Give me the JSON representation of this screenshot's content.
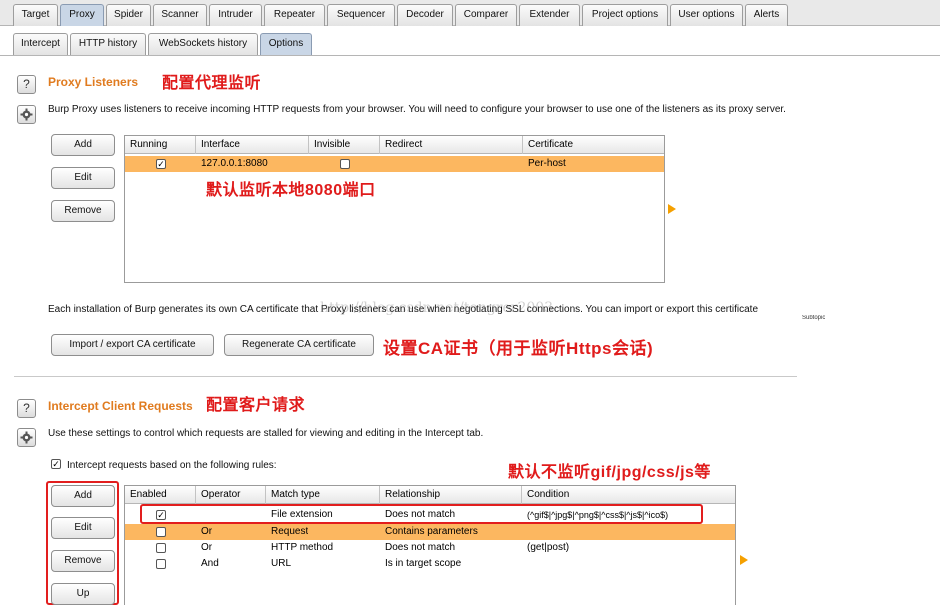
{
  "main_tabs": [
    "Target",
    "Proxy",
    "Spider",
    "Scanner",
    "Intruder",
    "Repeater",
    "Sequencer",
    "Decoder",
    "Comparer",
    "Extender",
    "Project options",
    "User options",
    "Alerts"
  ],
  "sub_tabs": [
    "Intercept",
    "HTTP history",
    "WebSockets history",
    "Options"
  ],
  "proxy_listeners": {
    "help_glyph": "?",
    "title": "Proxy Listeners",
    "annotation": "配置代理监听",
    "description": "Burp Proxy uses listeners to receive incoming HTTP requests from your browser. You will need to configure your browser to use one of the listeners as its proxy server.",
    "buttons": [
      "Add",
      "Edit",
      "Remove"
    ],
    "columns": [
      "Running",
      "Interface",
      "Invisible",
      "Redirect",
      "Certificate"
    ],
    "rows": [
      {
        "running": "✓",
        "interface": "127.0.0.1:8080",
        "invisible": "",
        "redirect": "",
        "certificate": "Per-host"
      }
    ],
    "row_annotation": "默认监听本地8080端口",
    "ca_text": "Each installation of Burp generates its own CA certificate that Proxy listeners can use when negotiating SSL connections. You can import or export this certificate",
    "import_button": "Import / export CA certificate",
    "regenerate_button": "Regenerate CA certificate",
    "ca_annotation": "设置CA证书（用于监听Https会话)",
    "side_note": "Subtopic"
  },
  "intercept_client": {
    "help_glyph": "?",
    "title": "Intercept Client Requests",
    "annotation": "配置客户请求",
    "description": "Use these settings to control which requests are stalled for viewing and editing in the Intercept tab.",
    "checkbox_mark": "✓",
    "checkbox_label": "Intercept requests based on the following rules:",
    "rules_annotation": "默认不监听gif/jpg/css/js等",
    "buttons": [
      "Add",
      "Edit",
      "Remove",
      "Up"
    ],
    "columns": [
      "Enabled",
      "Operator",
      "Match type",
      "Relationship",
      "Condition"
    ],
    "rows": [
      {
        "enabled": "✓",
        "operator": "",
        "match_type": "File extension",
        "relationship": "Does not match",
        "condition": "(^gif$|^jpg$|^png$|^css$|^js$|^ico$)"
      },
      {
        "enabled": "",
        "operator": "Or",
        "match_type": "Request",
        "relationship": "Contains parameters",
        "condition": ""
      },
      {
        "enabled": "",
        "operator": "Or",
        "match_type": "HTTP method",
        "relationship": "Does not match",
        "condition": "(get|post)"
      },
      {
        "enabled": "",
        "operator": "And",
        "match_type": "URL",
        "relationship": "Is in target scope",
        "condition": ""
      }
    ]
  },
  "watermark": "http://blog.csdn.net/tongrer2003",
  "colors": {
    "accent": "#e07b1f",
    "selected_row": "#fcb760",
    "annotation": "#e01b1b"
  }
}
